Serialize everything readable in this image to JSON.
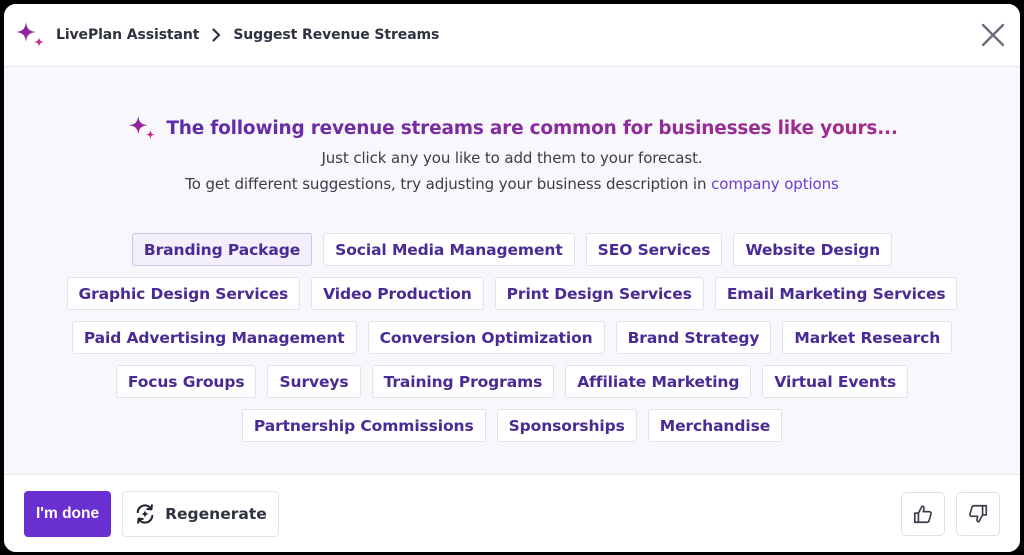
{
  "header": {
    "breadcrumb": [
      "LivePlan Assistant",
      "Suggest Revenue Streams"
    ],
    "close_icon": "close-icon",
    "logo_icon": "sparkle-icon"
  },
  "main": {
    "headline": "The following revenue streams are common for businesses like yours...",
    "instruction": "Just click any you like to add them to your forecast.",
    "hint_prefix": "To get different suggestions, try adjusting your business description in ",
    "hint_link": "company options",
    "chips": [
      {
        "label": "Branding Package",
        "hover": true
      },
      {
        "label": "Social Media Management"
      },
      {
        "label": "SEO Services"
      },
      {
        "label": "Website Design"
      },
      {
        "label": "Graphic Design Services"
      },
      {
        "label": "Video Production"
      },
      {
        "label": "Print Design Services"
      },
      {
        "label": "Email Marketing Services"
      },
      {
        "label": "Paid Advertising Management"
      },
      {
        "label": "Conversion Optimization"
      },
      {
        "label": "Brand Strategy"
      },
      {
        "label": "Market Research"
      },
      {
        "label": "Focus Groups"
      },
      {
        "label": "Surveys"
      },
      {
        "label": "Training Programs"
      },
      {
        "label": "Affiliate Marketing"
      },
      {
        "label": "Virtual Events"
      },
      {
        "label": "Partnership Commissions"
      },
      {
        "label": "Sponsorships"
      },
      {
        "label": "Merchandise"
      }
    ]
  },
  "footer": {
    "done_label": "I'm done",
    "regenerate_label": "Regenerate",
    "thumbs_up_icon": "thumbs-up-icon",
    "thumbs_down_icon": "thumbs-down-icon"
  },
  "colors": {
    "primary": "#6a2fd1",
    "chip_text": "#4a2a94",
    "link": "#6a3fd0",
    "body_bg": "#f8f7fc"
  }
}
